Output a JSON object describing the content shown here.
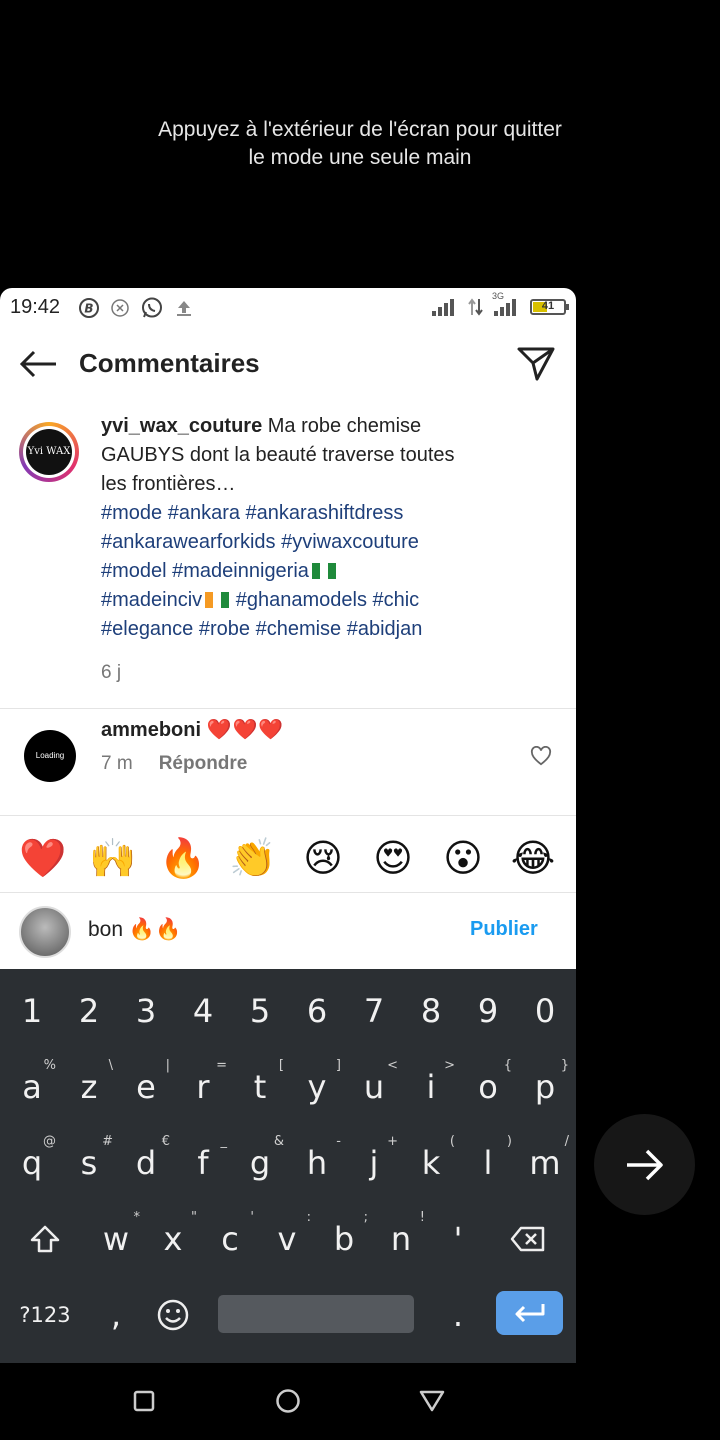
{
  "hint": {
    "line1": "Appuyez à l'extérieur de l'écran pour quitter",
    "line2": "le mode une seule main"
  },
  "status_bar": {
    "time": "19:42",
    "network_label": "3G",
    "battery": "41"
  },
  "header": {
    "title": "Commentaires"
  },
  "caption": {
    "username": "yvi_wax_couture",
    "text_line1": " Ma robe chemise",
    "text_line2": "GAUBYS dont la beauté traverse toutes",
    "text_line3": "les frontières…",
    "tags_line1": "#mode #ankara #ankarashiftdress",
    "tags_line2": "#ankarawearforkids #yviwaxcouture",
    "tags_line3": "#model #madeinnigeria",
    "tags_line4a": "#madeinciv",
    "tags_line4b": " #ghanamodels #chic",
    "tags_line5": "#elegance #robe #chemise #abidjan",
    "age": "6 j",
    "avatar_text": "Yvi WAX"
  },
  "comment": {
    "username": "ammeboni",
    "hearts": "❤️❤️❤️",
    "age": "7 m",
    "reply_label": "Répondre",
    "avatar_text": "Loading"
  },
  "emoji_bar": [
    "❤️",
    "🙌",
    "🔥",
    "👏",
    "😢",
    "😍",
    "😮",
    "😂"
  ],
  "input": {
    "value": "bon 🔥🔥",
    "publish_label": "Publier"
  },
  "keyboard": {
    "numbers": [
      "1",
      "2",
      "3",
      "4",
      "5",
      "6",
      "7",
      "8",
      "9",
      "0"
    ],
    "row1": [
      {
        "k": "a",
        "s": "%"
      },
      {
        "k": "z",
        "s": "\\"
      },
      {
        "k": "e",
        "s": "|"
      },
      {
        "k": "r",
        "s": "="
      },
      {
        "k": "t",
        "s": "["
      },
      {
        "k": "y",
        "s": "]"
      },
      {
        "k": "u",
        "s": "<"
      },
      {
        "k": "i",
        "s": ">"
      },
      {
        "k": "o",
        "s": "{"
      },
      {
        "k": "p",
        "s": "}"
      }
    ],
    "row2": [
      {
        "k": "q",
        "s": "@"
      },
      {
        "k": "s",
        "s": "#"
      },
      {
        "k": "d",
        "s": "€"
      },
      {
        "k": "f",
        "s": "_"
      },
      {
        "k": "g",
        "s": "&"
      },
      {
        "k": "h",
        "s": "-"
      },
      {
        "k": "j",
        "s": "+"
      },
      {
        "k": "k",
        "s": "("
      },
      {
        "k": "l",
        "s": ")"
      },
      {
        "k": "m",
        "s": "/"
      }
    ],
    "row3": [
      {
        "k": "w",
        "s": "*"
      },
      {
        "k": "x",
        "s": "\""
      },
      {
        "k": "c",
        "s": "'"
      },
      {
        "k": "v",
        "s": ":"
      },
      {
        "k": "b",
        "s": ";"
      },
      {
        "k": "n",
        "s": "!"
      },
      {
        "k": "'",
        "s": ""
      }
    ],
    "symbols_label": "?123",
    "comma": ",",
    "period": "."
  }
}
